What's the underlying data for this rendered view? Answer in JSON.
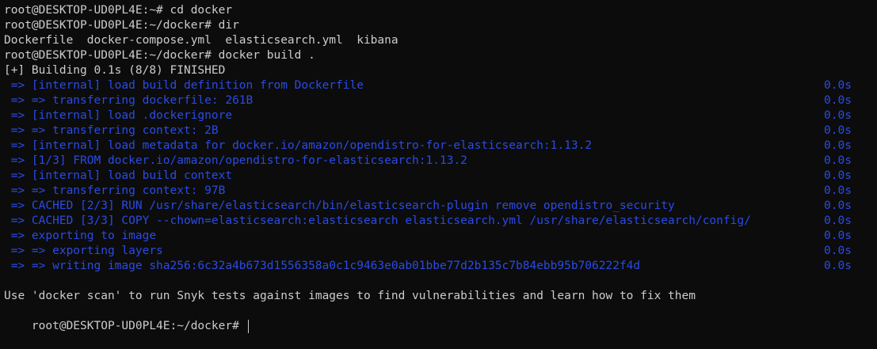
{
  "terminal": {
    "lines": [
      {
        "text": "root@DESKTOP-UD0PL4E:~# cd docker",
        "style": "plain"
      },
      {
        "text": "root@DESKTOP-UD0PL4E:~/docker# dir",
        "style": "plain"
      },
      {
        "text": "Dockerfile  docker-compose.yml  elasticsearch.yml  kibana",
        "style": "plain"
      },
      {
        "text": "root@DESKTOP-UD0PL4E:~/docker# docker build .",
        "style": "plain"
      },
      {
        "text": "[+] Building 0.1s (8/8) FINISHED",
        "style": "plain"
      },
      {
        "text": " => [internal] load build definition from Dockerfile",
        "style": "blue",
        "time": "0.0s"
      },
      {
        "text": " => => transferring dockerfile: 261B",
        "style": "blue",
        "time": "0.0s"
      },
      {
        "text": " => [internal] load .dockerignore",
        "style": "blue",
        "time": "0.0s"
      },
      {
        "text": " => => transferring context: 2B",
        "style": "blue",
        "time": "0.0s"
      },
      {
        "text": " => [internal] load metadata for docker.io/amazon/opendistro-for-elasticsearch:1.13.2",
        "style": "blue",
        "time": "0.0s"
      },
      {
        "text": " => [1/3] FROM docker.io/amazon/opendistro-for-elasticsearch:1.13.2",
        "style": "blue",
        "time": "0.0s"
      },
      {
        "text": " => [internal] load build context",
        "style": "blue",
        "time": "0.0s"
      },
      {
        "text": " => => transferring context: 97B",
        "style": "blue",
        "time": "0.0s"
      },
      {
        "text": " => CACHED [2/3] RUN /usr/share/elasticsearch/bin/elasticsearch-plugin remove opendistro_security",
        "style": "blue",
        "time": "0.0s"
      },
      {
        "text": " => CACHED [3/3] COPY --chown=elasticsearch:elasticsearch elasticsearch.yml /usr/share/elasticsearch/config/",
        "style": "blue",
        "time": "0.0s"
      },
      {
        "text": " => exporting to image",
        "style": "blue",
        "time": "0.0s"
      },
      {
        "text": " => => exporting layers",
        "style": "blue",
        "time": "0.0s"
      },
      {
        "text": " => => writing image sha256:6c32a4b673d1556358a0c1c9463e0ab01bbe77d2b135c7b84ebb95b706222f4d",
        "style": "blue",
        "time": "0.0s"
      },
      {
        "text": "",
        "style": "plain"
      },
      {
        "text": "Use 'docker scan' to run Snyk tests against images to find vulnerabilities and learn how to fix them",
        "style": "plain"
      }
    ],
    "prompt": "root@DESKTOP-UD0PL4E:~/docker# ",
    "colors": {
      "background": "#0c0c0c",
      "foreground": "#cccccc",
      "build_step": "#2a4be6"
    }
  }
}
